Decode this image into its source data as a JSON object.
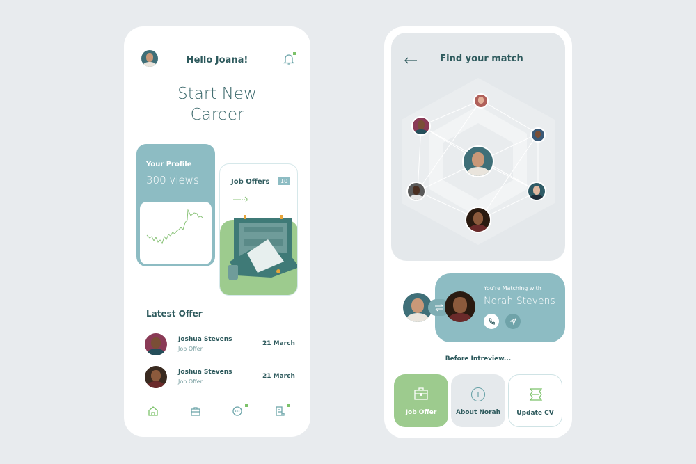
{
  "colors": {
    "teal": "#8dbcc3",
    "green": "#9dcb8e",
    "dark": "#2e5a5d",
    "panel": "#e5e9ec"
  },
  "home": {
    "greeting": "Hello Joana!",
    "title_line1": "Start New",
    "title_line2": "Career",
    "profile_card": {
      "label": "Your Profile",
      "views": "300 views"
    },
    "job_offers_card": {
      "label": "Job Offers",
      "count": "10"
    },
    "latest_offer": {
      "heading": "Latest Offer",
      "items": [
        {
          "name": "Joshua Stevens",
          "subtitle": "Job Offer",
          "date": "21 March"
        },
        {
          "name": "Joshua Stevens",
          "subtitle": "Job Offer",
          "date": "21 March"
        }
      ]
    },
    "nav": [
      "home-icon",
      "briefcase-icon",
      "chat-icon",
      "document-icon"
    ]
  },
  "match": {
    "title": "Find your match",
    "matching_label": "You're Matching with",
    "match_name": "Norah Stevens",
    "section_label": "Before Intreview...",
    "actions": [
      {
        "label": "Job Offer"
      },
      {
        "label": "About Norah"
      },
      {
        "label": "Update CV"
      }
    ]
  }
}
